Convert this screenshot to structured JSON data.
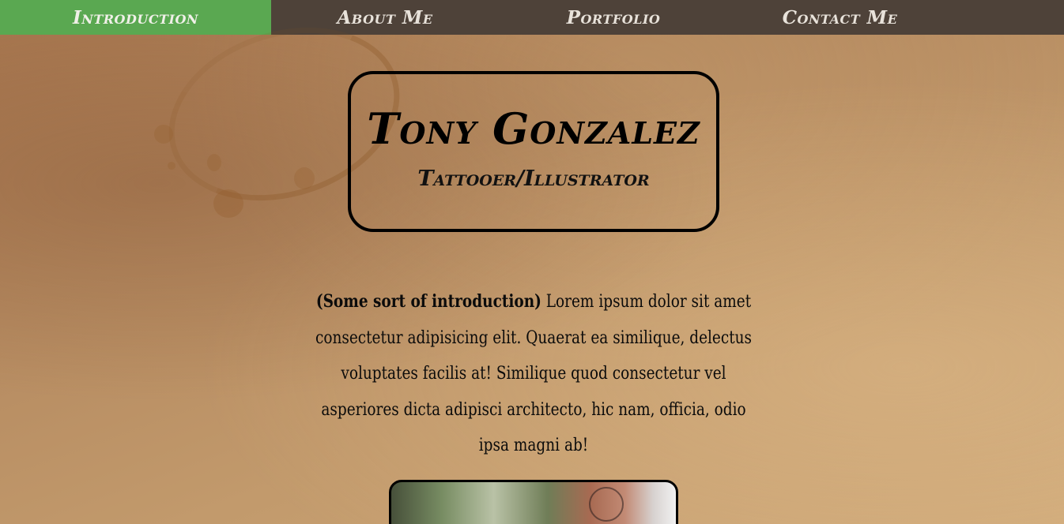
{
  "nav": {
    "items": [
      {
        "label": "Introduction",
        "active": true
      },
      {
        "label": "About Me",
        "active": false
      },
      {
        "label": "Portfolio",
        "active": false
      },
      {
        "label": "Contact Me",
        "active": false
      }
    ]
  },
  "header": {
    "name": "Tony Gonzalez",
    "role": "Tattooer/Illustrator"
  },
  "intro": {
    "lead": "(Some sort of introduction)",
    "body": " Lorem ipsum dolor sit amet consectetur adipisicing elit. Quaerat ea similique, delectus voluptates facilis at! Similique quod consectetur vel asperiores dicta adipisci architecto, hic nam, officia, odio ipsa magni ab!"
  },
  "colors": {
    "nav_background": "#4e4239",
    "nav_active": "#5aa851",
    "text": "#000000"
  }
}
